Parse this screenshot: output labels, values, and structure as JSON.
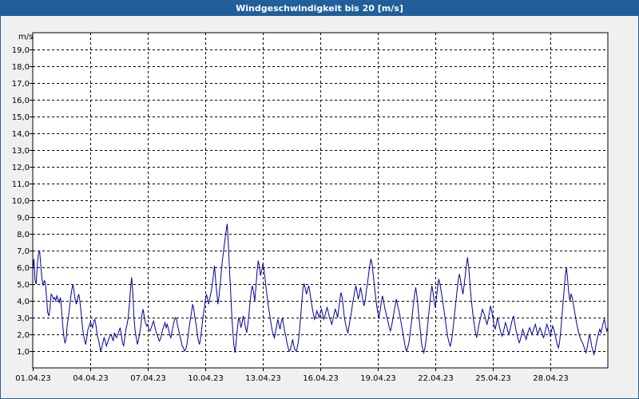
{
  "window": {
    "title": "Windgeschwindigkeit bis 20 [m/s]"
  },
  "colors": {
    "series": "#00009c",
    "grid": "#000000",
    "plot_bg": "#ffffff",
    "title_bar": "#1f5f9b"
  },
  "chart_data": {
    "type": "line",
    "title": "Windgeschwindigkeit bis 20 [m/s]",
    "ylabel": "m/s",
    "xlabel": "",
    "ylim": [
      0,
      20
    ],
    "y_ticks": [
      "1,0",
      "2,0",
      "3,0",
      "4,0",
      "5,0",
      "6,0",
      "7,0",
      "8,0",
      "9,0",
      "10,0",
      "11,0",
      "12,0",
      "13,0",
      "14,0",
      "15,0",
      "16,0",
      "17,0",
      "18,0",
      "19,0"
    ],
    "x_ticks": [
      "01.04.23",
      "04.04.23",
      "07.04.23",
      "10.04.23",
      "13.04.23",
      "16.04.23",
      "19.04.23",
      "22.04.23",
      "25.04.23",
      "28.04.23"
    ],
    "xlim_days": [
      1,
      31
    ],
    "grid": true,
    "series": [
      {
        "values": [
          5.8,
          6.5,
          5.2,
          5.0,
          6.2,
          6.8,
          7.0,
          6.1,
          5.3,
          4.9,
          5.2,
          5.1,
          4.2,
          3.3,
          3.1,
          3.6,
          4.4,
          4.3,
          4.1,
          4.2,
          4.0,
          4.3,
          4.1,
          3.9,
          4.2,
          3.5,
          2.6,
          1.9,
          1.5,
          1.7,
          2.6,
          3.0,
          3.6,
          4.2,
          4.7,
          5.0,
          4.5,
          4.0,
          3.8,
          4.2,
          4.4,
          4.0,
          3.3,
          2.6,
          2.0,
          1.7,
          1.4,
          1.8,
          2.3,
          2.5,
          2.7,
          2.6,
          2.4,
          2.8,
          2.9,
          2.5,
          2.0,
          1.7,
          1.4,
          1.0,
          1.2,
          1.5,
          1.8,
          1.6,
          1.3,
          1.5,
          1.7,
          1.9,
          2.0,
          1.8,
          1.6,
          2.1,
          1.9,
          1.8,
          2.0,
          2.2,
          2.4,
          2.0,
          1.5,
          1.3,
          1.8,
          2.3,
          2.6,
          3.0,
          3.8,
          4.7,
          5.4,
          4.5,
          3.0,
          2.2,
          1.8,
          1.4,
          1.7,
          2.1,
          2.5,
          3.2,
          3.5,
          3.0,
          2.7,
          2.5,
          2.6,
          2.3,
          2.2,
          2.4,
          2.6,
          2.8,
          2.5,
          2.2,
          2.0,
          1.8,
          1.6,
          1.7,
          2.0,
          2.3,
          2.5,
          2.7,
          2.4,
          2.6,
          2.3,
          2.0,
          1.8,
          2.1,
          2.5,
          2.8,
          3.0,
          2.9,
          2.5,
          2.2,
          1.9,
          1.6,
          1.3,
          1.2,
          1.0,
          1.1,
          1.4,
          1.9,
          2.4,
          2.9,
          3.3,
          3.8,
          3.5,
          3.0,
          2.6,
          2.1,
          1.6,
          1.4,
          1.8,
          2.4,
          3.0,
          3.5,
          4.0,
          4.4,
          4.1,
          3.8,
          4.2,
          4.5,
          4.9,
          5.5,
          6.1,
          5.2,
          4.5,
          3.8,
          4.3,
          5.0,
          5.8,
          6.5,
          7.0,
          7.6,
          8.1,
          8.6,
          7.5,
          6.0,
          4.6,
          3.2,
          2.1,
          1.3,
          0.9,
          1.7,
          2.4,
          3.0,
          2.8,
          2.4,
          2.7,
          3.1,
          2.8,
          2.4,
          2.1,
          2.6,
          3.2,
          4.0,
          4.6,
          4.9,
          4.5,
          4.0,
          4.8,
          5.7,
          6.4,
          6.1,
          5.5,
          5.8,
          6.2,
          5.9,
          5.3,
          4.7,
          4.1,
          3.6,
          3.2,
          2.7,
          2.3,
          2.0,
          1.8,
          2.1,
          2.5,
          2.9,
          2.6,
          2.3,
          2.7,
          3.0,
          2.6,
          2.2,
          1.9,
          1.5,
          1.2,
          1.0,
          1.1,
          1.4,
          1.7,
          1.3,
          1.1,
          1.0,
          1.2,
          1.6,
          2.3,
          3.1,
          4.0,
          4.8,
          5.0,
          4.7,
          4.4,
          4.7,
          4.9,
          4.5,
          4.0,
          3.6,
          3.2,
          2.9,
          3.1,
          3.4,
          3.2,
          3.0,
          3.3,
          3.5,
          3.2,
          2.9,
          3.1,
          3.4,
          3.6,
          3.3,
          3.0,
          2.8,
          2.6,
          2.9,
          3.2,
          3.5,
          3.3,
          3.0,
          3.5,
          4.1,
          4.5,
          4.2,
          3.6,
          3.0,
          2.6,
          2.3,
          2.1,
          2.5,
          2.9,
          3.3,
          3.8,
          4.2,
          4.6,
          4.9,
          4.5,
          4.1,
          4.4,
          4.8,
          4.5,
          4.0,
          3.7,
          4.0,
          4.6,
          5.0,
          5.6,
          6.1,
          6.5,
          6.2,
          5.6,
          4.9,
          4.3,
          3.7,
          3.3,
          3.0,
          3.4,
          3.9,
          4.3,
          4.0,
          3.6,
          3.3,
          3.0,
          2.7,
          2.4,
          2.2,
          2.5,
          2.9,
          3.3,
          3.7,
          4.1,
          3.8,
          3.5,
          3.2,
          2.8,
          2.4,
          2.0,
          1.6,
          1.2,
          1.0,
          1.2,
          1.5,
          2.0,
          2.6,
          3.2,
          3.8,
          4.4,
          4.8,
          4.3,
          3.6,
          2.9,
          2.2,
          1.5,
          1.1,
          0.9,
          1.2,
          1.7,
          2.3,
          3.0,
          3.7,
          4.4,
          4.9,
          4.5,
          4.0,
          3.6,
          4.2,
          4.8,
          5.3,
          5.0,
          4.6,
          4.2,
          3.7,
          3.2,
          2.7,
          2.2,
          1.8,
          1.5,
          1.3,
          1.6,
          2.1,
          2.7,
          3.4,
          4.0,
          4.7,
          5.3,
          5.6,
          5.2,
          4.8,
          4.4,
          4.9,
          5.5,
          6.1,
          6.6,
          6.0,
          5.1,
          4.3,
          3.6,
          3.0,
          2.5,
          2.1,
          1.8,
          2.2,
          2.6,
          2.9,
          3.2,
          3.5,
          3.3,
          3.1,
          2.8,
          2.6,
          2.9,
          3.3,
          3.7,
          3.4,
          3.0,
          2.6,
          2.3,
          2.6,
          3.0,
          2.7,
          2.4,
          2.1,
          1.9,
          2.1,
          2.4,
          2.7,
          2.5,
          2.2,
          2.0,
          2.3,
          2.6,
          2.9,
          3.1,
          2.7,
          2.3,
          2.0,
          1.7,
          1.5,
          1.7,
          2.0,
          2.3,
          2.1,
          1.9,
          1.7,
          2.0,
          2.2,
          2.4,
          2.2,
          2.0,
          2.2,
          2.4,
          2.6,
          2.3,
          2.0,
          2.2,
          2.4,
          2.2,
          2.0,
          1.8,
          2.0,
          2.3,
          2.6,
          2.4,
          2.1,
          1.9,
          2.2,
          2.5,
          2.3,
          2.0,
          1.7,
          1.4,
          1.2,
          1.5,
          2.2,
          3.0,
          3.8,
          4.7,
          5.5,
          6.0,
          5.3,
          4.5,
          4.0,
          4.4,
          4.2,
          3.8,
          3.4,
          3.0,
          2.6,
          2.3,
          2.0,
          1.8,
          1.6,
          1.5,
          1.3,
          1.1,
          0.9,
          1.2,
          1.6,
          2.0,
          1.7,
          1.3,
          1.0,
          0.8,
          1.1,
          1.5,
          1.8,
          2.1,
          2.3,
          2.1,
          2.4,
          2.7,
          2.9,
          2.5,
          2.2,
          2.4
        ]
      }
    ]
  }
}
